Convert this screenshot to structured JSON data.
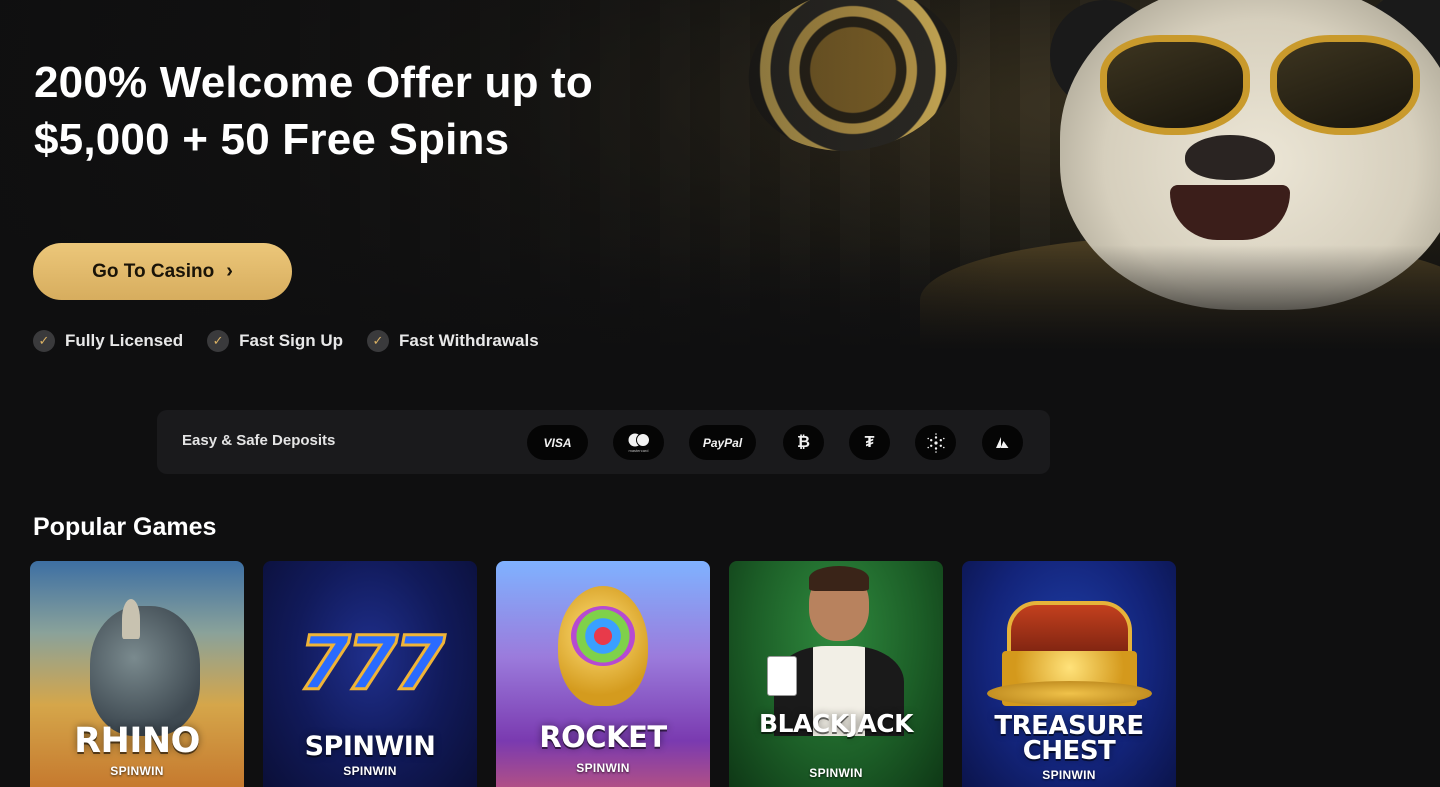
{
  "hero": {
    "title": "200% Welcome Offer up to $5,000 + 50 Free Spins",
    "cta_label": "Go To Casino",
    "features": [
      "Fully Licensed",
      "Fast Sign Up",
      "Fast Withdrawals"
    ]
  },
  "deposits": {
    "label": "Easy & Safe Deposits",
    "methods": [
      "VISA",
      "mastercard",
      "PayPal",
      "bitcoin",
      "tether",
      "cardano",
      "avalanche"
    ]
  },
  "games": {
    "title": "Popular Games",
    "items": [
      {
        "name": "RHINO",
        "provider": "SPINWIN"
      },
      {
        "name": "SPINWIN",
        "provider": "SPINWIN"
      },
      {
        "name": "ROCKET",
        "provider": "SPINWIN"
      },
      {
        "name": "BLACKJACK",
        "provider": "SPINWIN"
      },
      {
        "name": "TREASURE CHEST",
        "provider": "SPINWIN"
      }
    ]
  },
  "colors": {
    "background": "#0f0f10",
    "accent_gold": "#d7ad5e",
    "panel": "#1a1a1c"
  }
}
